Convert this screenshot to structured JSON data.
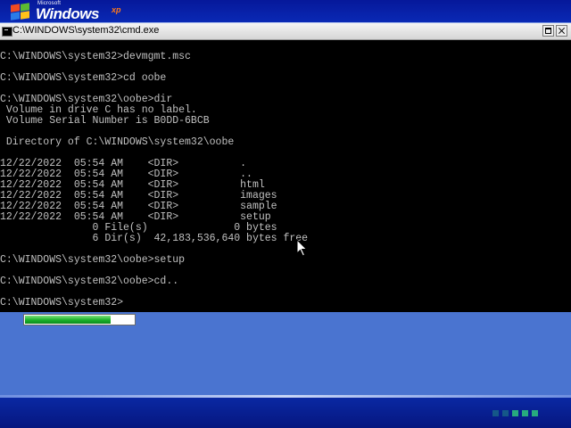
{
  "branding": {
    "microsoft": "Microsoft",
    "windows": "Windows",
    "xp": "xp"
  },
  "window": {
    "title": "C:\\WINDOWS\\system32\\cmd.exe",
    "icon": "console-icon",
    "buttons": [
      "restore-button",
      "close-button"
    ]
  },
  "console": {
    "lines": [
      "",
      "C:\\WINDOWS\\system32>devmgmt.msc",
      "",
      "C:\\WINDOWS\\system32>cd oobe",
      "",
      "C:\\WINDOWS\\system32\\oobe>dir",
      " Volume in drive C has no label.",
      " Volume Serial Number is B0DD-6BCB",
      "",
      " Directory of C:\\WINDOWS\\system32\\oobe",
      "",
      "12/22/2022  05:54 AM    <DIR>          .",
      "12/22/2022  05:54 AM    <DIR>          ..",
      "12/22/2022  05:54 AM    <DIR>          html",
      "12/22/2022  05:54 AM    <DIR>          images",
      "12/22/2022  05:54 AM    <DIR>          sample",
      "12/22/2022  05:54 AM    <DIR>          setup",
      "               0 File(s)              0 bytes",
      "               6 Dir(s)  42,183,536,640 bytes free",
      "",
      "C:\\WINDOWS\\system32\\oobe>setup",
      "",
      "C:\\WINDOWS\\system32\\oobe>cd..",
      "",
      "C:\\WINDOWS\\system32>"
    ]
  },
  "progress": {
    "fraction": 0.79,
    "color": "#18b22a"
  },
  "colors": {
    "desktop": "#4a74d0",
    "band": "#06189a",
    "console_bg": "#000000",
    "console_fg": "#c0c0c0"
  }
}
